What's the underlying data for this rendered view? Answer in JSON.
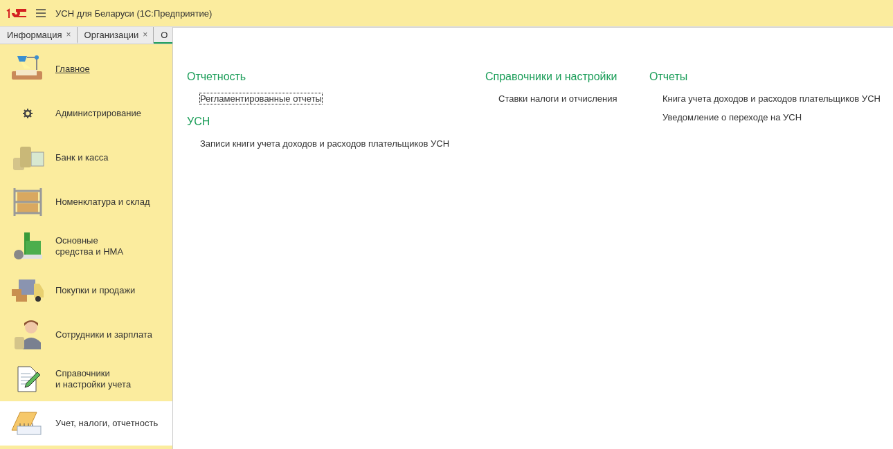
{
  "window": {
    "title": "УСН для Беларуси  (1С:Предприятие)"
  },
  "tabs": [
    {
      "label": "Информация",
      "selected": false,
      "close": "×"
    },
    {
      "label": "Организации",
      "selected": false,
      "close": "×"
    },
    {
      "label": "О",
      "selected": true
    }
  ],
  "sidebar": {
    "items": [
      {
        "label": "Главное",
        "selected": false,
        "underlined": true
      },
      {
        "label": "Администрирование",
        "selected": false,
        "underlined": false
      },
      {
        "label": "Банк и касса",
        "selected": false,
        "underlined": false
      },
      {
        "label": "Номенклатура и склад",
        "selected": false,
        "underlined": false
      },
      {
        "label": "Основные\nсредства и НМА",
        "selected": false,
        "underlined": false
      },
      {
        "label": "Покупки и продажи",
        "selected": false,
        "underlined": false
      },
      {
        "label": "Сотрудники и зарплата",
        "selected": false,
        "underlined": false
      },
      {
        "label": "Справочники\nи настройки учета",
        "selected": false,
        "underlined": false
      },
      {
        "label": "Учет, налоги, отчетность",
        "selected": true,
        "underlined": false
      }
    ]
  },
  "panel": {
    "columns": [
      {
        "groups": [
          {
            "heading": "Отчетность",
            "links": [
              {
                "label": "Регламентированные отчеты",
                "focused": true
              }
            ]
          },
          {
            "heading": "УСН",
            "links": [
              {
                "label": "Записи книги учета доходов и расходов плательщиков УСН",
                "focused": false
              }
            ]
          }
        ]
      },
      {
        "groups": [
          {
            "heading": "Справочники и настройки",
            "links": [
              {
                "label": "Ставки налоги и отчисления",
                "focused": false
              }
            ]
          }
        ]
      },
      {
        "groups": [
          {
            "heading": "Отчеты",
            "links": [
              {
                "label": "Книга учета доходов и расходов плательщиков УСН",
                "focused": false
              },
              {
                "label": "Уведомление о переходе на УСН",
                "focused": false
              }
            ]
          }
        ]
      }
    ]
  }
}
